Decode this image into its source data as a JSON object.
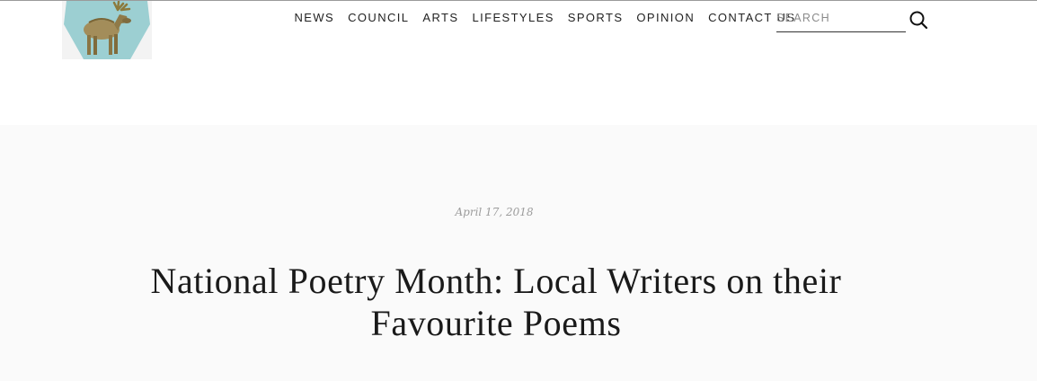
{
  "header": {
    "logo_name": "moose-logo"
  },
  "nav": {
    "items": [
      "NEWS",
      "COUNCIL",
      "ARTS",
      "LIFESTYLES",
      "SPORTS",
      "OPINION",
      "CONTACT US"
    ]
  },
  "search": {
    "placeholder": "SEARCH",
    "value": "",
    "icon": "search-icon"
  },
  "article": {
    "date": "April 17, 2018",
    "title": "National Poetry Month: Local Writers on their Favourite Poems"
  },
  "colors": {
    "logo_background": "#9ccfd2",
    "hero_background": "#fafafa",
    "text": "#1a1a1a",
    "date": "#9c9c9c"
  }
}
